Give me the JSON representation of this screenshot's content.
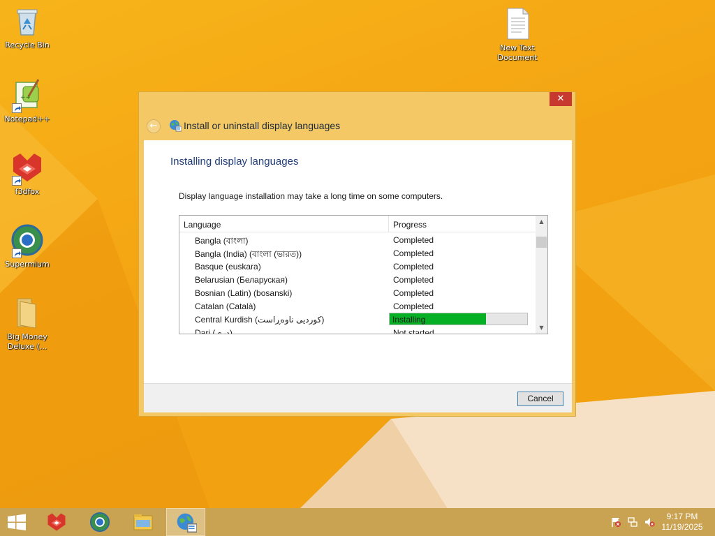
{
  "desktop": {
    "icons": [
      {
        "label": "Recycle Bin",
        "icon": "recycle-bin-icon"
      },
      {
        "label": "Notepad++",
        "icon": "notepad-plus-plus-icon"
      },
      {
        "label": "f3dfox",
        "icon": "f3dfox-icon"
      },
      {
        "label": "Supermium",
        "icon": "supermium-icon"
      },
      {
        "label": "Big Money Deluxe (...",
        "icon": "folder-icon"
      },
      {
        "label": "New Text Document",
        "icon": "text-document-icon"
      }
    ]
  },
  "window": {
    "title": "Install or uninstall display languages",
    "close_label": "✕",
    "back_label": "←",
    "heading": "Installing display languages",
    "description": "Display language installation may take a long time on some computers.",
    "columns": {
      "language": "Language",
      "progress": "Progress"
    },
    "rows": [
      {
        "language": "Bangla (বাংলা)",
        "progress": "Completed"
      },
      {
        "language": "Bangla (India) (বাংলা (ভারত))",
        "progress": "Completed"
      },
      {
        "language": "Basque (euskara)",
        "progress": "Completed"
      },
      {
        "language": "Belarusian (Беларуская)",
        "progress": "Completed"
      },
      {
        "language": "Bosnian (Latin) (bosanski)",
        "progress": "Completed"
      },
      {
        "language": "Catalan (Català)",
        "progress": "Completed"
      },
      {
        "language": "Central Kurdish (کوردیی ناوەڕاست)",
        "progress": "Installing",
        "fraction": 0.7
      },
      {
        "language": "Dari (دری)",
        "progress": "Not started"
      }
    ],
    "cancel_label": "Cancel"
  },
  "colors": {
    "progress_fill": "#06b025",
    "close_button": "#c7392f",
    "heading": "#1e3d7a"
  },
  "taskbar": {
    "items": [
      {
        "name": "start-icon"
      },
      {
        "name": "f3dfox-icon"
      },
      {
        "name": "supermium-icon"
      },
      {
        "name": "file-explorer-icon"
      },
      {
        "name": "display-language-icon",
        "active": true
      }
    ],
    "tray": [
      "action-center-flag-icon",
      "network-icon",
      "volume-muted-icon"
    ],
    "clock_time": "9:17 PM",
    "clock_date": "11/19/2025"
  }
}
